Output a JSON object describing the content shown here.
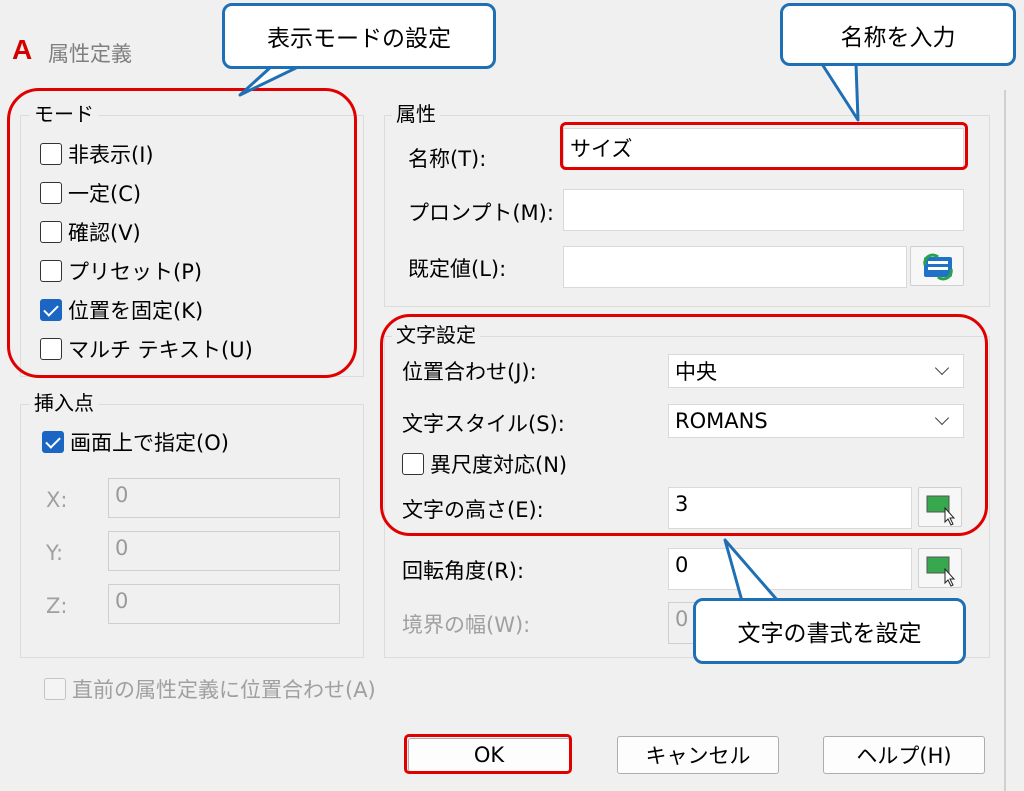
{
  "window": {
    "app_icon": "A",
    "title": "属性定義"
  },
  "mode": {
    "legend": "モード",
    "items": [
      {
        "label": "非表示(I)",
        "checked": false
      },
      {
        "label": "一定(C)",
        "checked": false
      },
      {
        "label": "確認(V)",
        "checked": false
      },
      {
        "label": "プリセット(P)",
        "checked": false
      },
      {
        "label": "位置を固定(K)",
        "checked": true
      },
      {
        "label": "マルチ テキスト(U)",
        "checked": false
      }
    ]
  },
  "insertion": {
    "legend": "挿入点",
    "specify_on_screen": {
      "label": "画面上で指定(O)",
      "checked": true
    },
    "x": {
      "label": "X:",
      "value": "0"
    },
    "y": {
      "label": "Y:",
      "value": "0"
    },
    "z": {
      "label": "Z:",
      "value": "0"
    }
  },
  "attribute": {
    "legend": "属性",
    "tag": {
      "label": "名称(T):",
      "value": "サイズ"
    },
    "prompt": {
      "label": "プロンプト(M):",
      "value": ""
    },
    "default": {
      "label": "既定値(L):",
      "value": ""
    }
  },
  "text_settings": {
    "legend": "文字設定",
    "justification": {
      "label": "位置合わせ(J):",
      "value": "中央"
    },
    "text_style": {
      "label": "文字スタイル(S):",
      "value": "ROMANS"
    },
    "annotative": {
      "label": "異尺度対応(N)",
      "checked": false
    },
    "text_height": {
      "label": "文字の高さ(E):",
      "value": "3"
    },
    "rotation": {
      "label": "回転角度(R):",
      "value": "0"
    },
    "boundary_width": {
      "label": "境界の幅(W):",
      "value": "0"
    }
  },
  "align_below": {
    "label": "直前の属性定義に位置合わせ(A)",
    "checked": false
  },
  "buttons": {
    "ok": "OK",
    "cancel": "キャンセル",
    "help": "ヘルプ(H)"
  },
  "callouts": {
    "mode": "表示モードの設定",
    "name": "名称を入力",
    "text_format": "文字の書式を設定"
  },
  "colors": {
    "highlight": "#e00000",
    "callout_border": "#1f6fb5",
    "checkbox": "#1a66c2"
  },
  "icons": {
    "field_insert": "insert-field-icon",
    "pick_point": "pick-point-icon",
    "dropdown": "chevron-down-icon"
  }
}
